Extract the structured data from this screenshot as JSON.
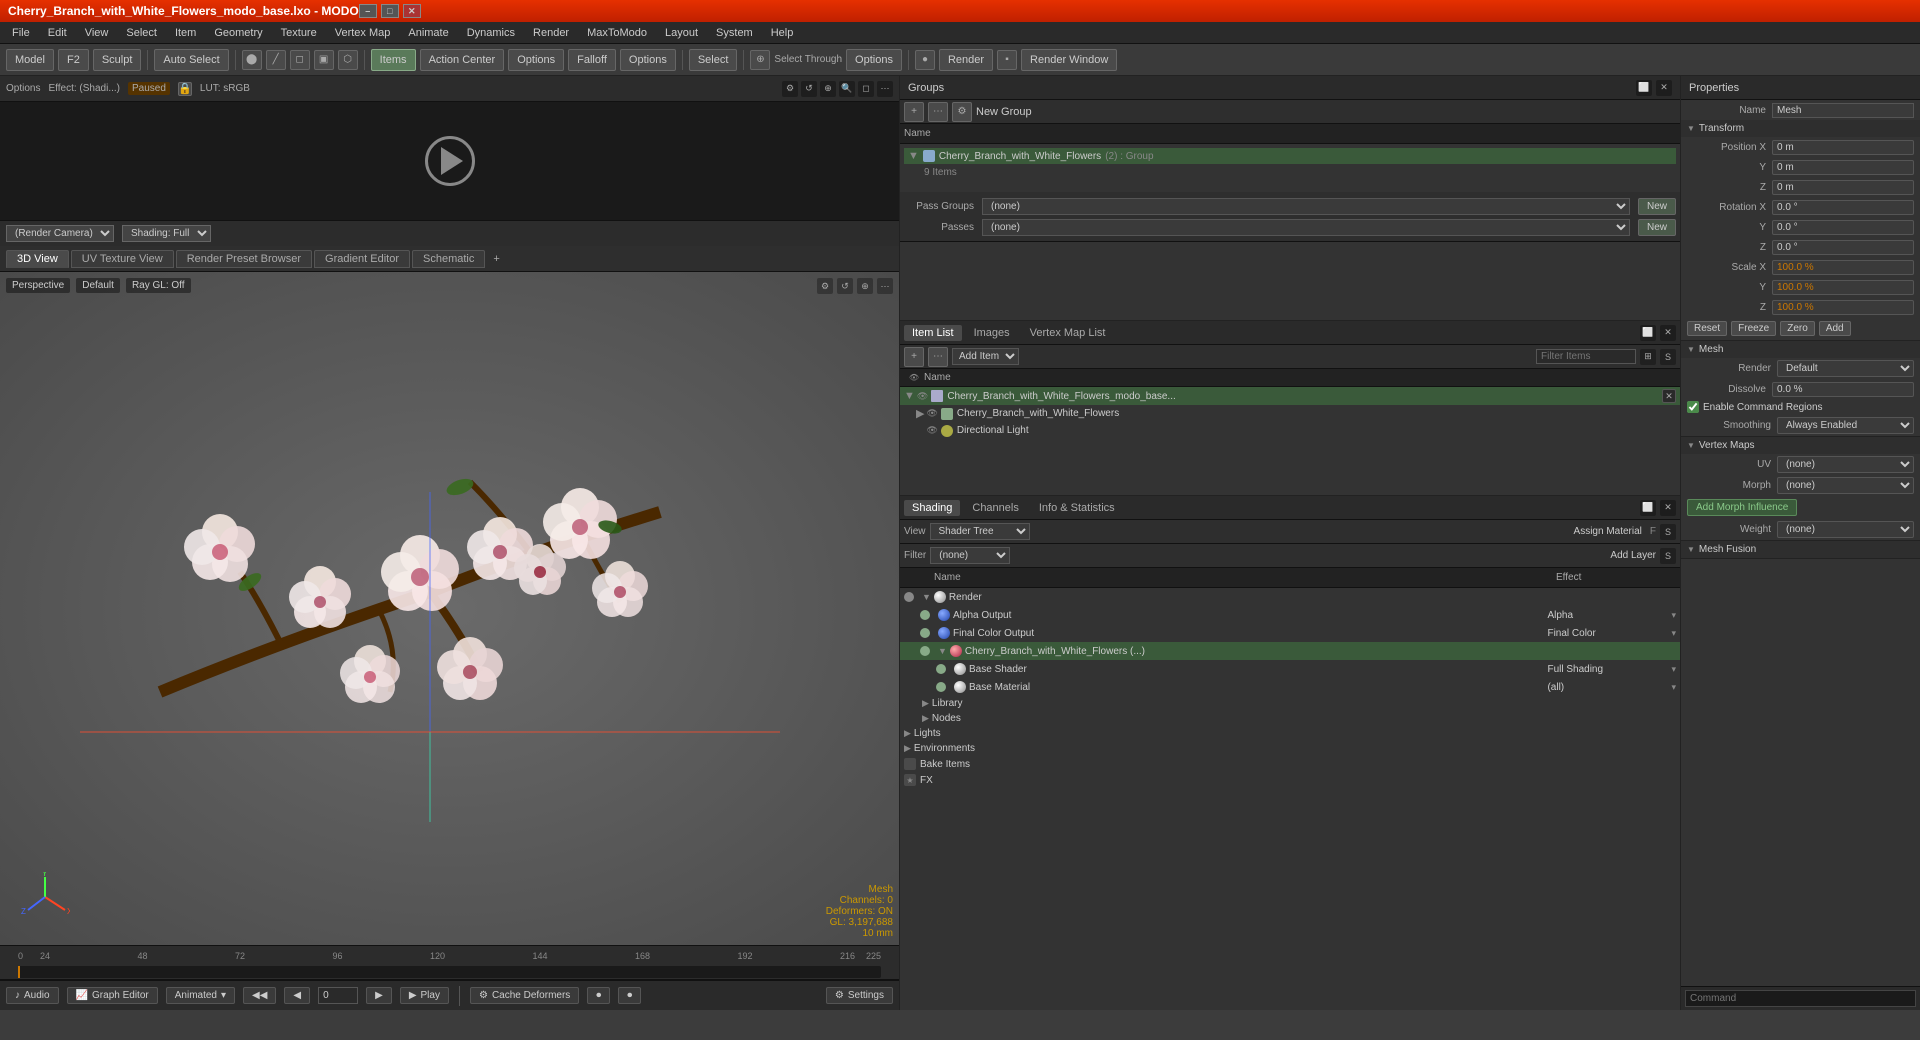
{
  "titlebar": {
    "title": "Cherry_Branch_with_White_Flowers_modo_base.lxo - MODO",
    "win_min": "–",
    "win_max": "□",
    "win_close": "✕"
  },
  "menubar": {
    "items": [
      "File",
      "Edit",
      "View",
      "Select",
      "Item",
      "Geometry",
      "Texture",
      "Vertex Map",
      "Animate",
      "Dynamics",
      "Render",
      "MaxToModo",
      "Layout",
      "System",
      "Help"
    ]
  },
  "toolbar": {
    "left_tabs": [
      "Model",
      "F2",
      "Sculpt"
    ],
    "auto_select": "Auto Select",
    "mode_items": [
      {
        "label": "Items",
        "active": true
      },
      {
        "label": "Action Center",
        "active": false
      },
      {
        "label": "Options",
        "active": false
      },
      {
        "label": "Falloff",
        "active": false
      },
      {
        "label": "Options",
        "active": false
      }
    ],
    "select_label": "Select",
    "select_through": "Select Through",
    "render_label": "Render",
    "render_window": "Render Window"
  },
  "preview": {
    "options_label": "Options",
    "effect_label": "Effect: (Shadi...)",
    "paused_label": "Paused",
    "lut_label": "LUT: sRGB",
    "render_camera": "(Render Camera)",
    "shading": "Shading: Full"
  },
  "viewport_tabs": {
    "tabs": [
      "3D View",
      "UV Texture View",
      "Render Preset Browser",
      "Gradient Editor",
      "Schematic"
    ],
    "active_tab": "3D View",
    "add_label": "+"
  },
  "viewport": {
    "perspective_label": "Perspective",
    "default_label": "Default",
    "ray_gl_label": "Ray GL: Off",
    "mesh_label": "Mesh",
    "channels_label": "Channels: 0",
    "deformers_label": "Deformers: ON",
    "gl_label": "GL: 3,197,688",
    "size_label": "10 mm"
  },
  "groups_panel": {
    "title": "Groups",
    "new_group_label": "New Group",
    "name_col": "Name",
    "group_name": "Cherry_Branch_with_White_Flowers",
    "group_suffix": "(2) : Group",
    "group_items_count": "9 Items",
    "pass_groups_label": "Pass Groups",
    "passes_label": "Passes",
    "none_label": "(none)",
    "new_btn": "New",
    "new_btn2": "New"
  },
  "item_list": {
    "tabs": [
      "Item List",
      "Images",
      "Vertex Map List"
    ],
    "add_item_label": "Add Item",
    "filter_label": "Filter Items",
    "name_col": "Name",
    "items": [
      {
        "name": "Cherry_Branch_with_White_Flowers_modo_base...",
        "level": 1,
        "type": "group",
        "arrow": "▼",
        "selected": true
      },
      {
        "name": "Cherry_Branch_with_White_Flowers",
        "level": 2,
        "type": "mesh",
        "arrow": "▶",
        "selected": false
      },
      {
        "name": "Directional Light",
        "level": 2,
        "type": "light",
        "arrow": "",
        "selected": false
      }
    ]
  },
  "shading_panel": {
    "tabs": [
      "Shading",
      "Channels",
      "Info & Statistics"
    ],
    "active_tab": "Shading",
    "view_label": "View",
    "shader_tree": "Shader Tree",
    "assign_material": "Assign Material",
    "filter_label": "Filter",
    "none_label": "(none)",
    "add_layer": "Add Layer",
    "name_col": "Name",
    "effect_col": "Effect",
    "rows": [
      {
        "name": "Render",
        "effect": "",
        "type": "render",
        "level": 0,
        "arrow": "▼"
      },
      {
        "name": "Alpha Output",
        "effect": "Alpha",
        "type": "item",
        "level": 1
      },
      {
        "name": "Final Color Output",
        "effect": "Final Color",
        "type": "item",
        "level": 1
      },
      {
        "name": "Cherry_Branch_with_White_Flowers (...)",
        "effect": "",
        "type": "group",
        "level": 1
      },
      {
        "name": "Base Shader",
        "effect": "Full Shading",
        "type": "item",
        "level": 2
      },
      {
        "name": "Base Material",
        "effect": "(all)",
        "type": "item",
        "level": 2
      }
    ],
    "tree_items": [
      {
        "name": "Library",
        "level": 1,
        "arrow": "▶"
      },
      {
        "name": "Nodes",
        "level": 1,
        "arrow": "▶"
      },
      {
        "name": "Lights",
        "level": 0,
        "arrow": "▶"
      },
      {
        "name": "Environments",
        "level": 0,
        "arrow": "▶"
      },
      {
        "name": "Bake Items",
        "level": 0
      },
      {
        "name": "FX",
        "level": 0
      }
    ]
  },
  "properties": {
    "title": "Properties",
    "name_label": "Name",
    "name_value": "Mesh",
    "transform_section": "Transform",
    "position_x": "0 m",
    "position_y": "0 m",
    "position_z": "0 m",
    "rotation_x": "0.0 °",
    "rotation_y": "0.0 °",
    "rotation_z": "0.0 °",
    "scale_x": "100.0 %",
    "scale_y": "100.0 %",
    "scale_z": "100.0 %",
    "reset_btn": "Reset",
    "freeze_btn": "Freeze",
    "zero_btn": "Zero",
    "add_btn": "Add",
    "mesh_section": "Mesh",
    "render_label": "Render",
    "render_value": "Default",
    "dissolve_label": "Dissolve",
    "dissolve_value": "0.0 %",
    "enable_cmd_regions": "Enable Command Regions",
    "smoothing_label": "Smoothing",
    "smoothing_value": "Always Enabled",
    "vertex_maps_section": "Vertex Maps",
    "uv_label": "UV",
    "uv_value": "(none)",
    "morph_label": "Morph",
    "morph_value": "(none)",
    "add_morph_btn": "Add Morph Influence",
    "weight_label": "Weight",
    "weight_value": "(none)",
    "mesh_fusion_section": "Mesh Fusion"
  },
  "statusbar": {
    "audio_label": "Audio",
    "graph_editor": "Graph Editor",
    "animated_label": "Animated",
    "play_label": "Play",
    "cache_label": "Cache Deformers",
    "settings_label": "Settings",
    "command_label": "Command"
  },
  "timeline": {
    "markers": [
      "0",
      "24",
      "48",
      "72",
      "96",
      "120",
      "144",
      "168",
      "192",
      "216"
    ],
    "end_marker": "225",
    "position": "0"
  }
}
